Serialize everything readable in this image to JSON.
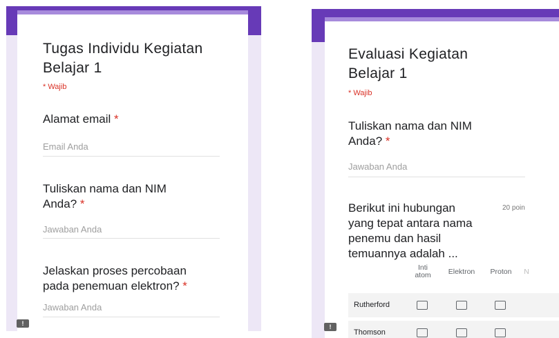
{
  "left_form": {
    "title_line1": "Tugas Individu Kegiatan",
    "title_line2": "Belajar 1",
    "required_note": "* Wajib",
    "q1_label": "Alamat email",
    "q1_placeholder": "Email Anda",
    "q2_line1": "Tuliskan nama dan NIM",
    "q2_line2": "Anda?",
    "q2_placeholder": "Jawaban Anda",
    "q3_line1": "Jelaskan proses percobaan",
    "q3_line2": "pada penemuan elektron?",
    "q3_placeholder": "Jawaban Anda",
    "required_star": "*",
    "feedback_glyph": "!"
  },
  "right_form": {
    "title_line1": "Evaluasi Kegiatan",
    "title_line2": "Belajar 1",
    "required_note": "* Wajib",
    "q1_line1": "Tuliskan nama dan NIM",
    "q1_line2": "Anda?",
    "q1_placeholder": "Jawaban Anda",
    "required_star": "*",
    "q2_line1": "Berikut ini hubungan",
    "q2_line2": "yang tepat antara nama",
    "q2_line3": "penemu dan hasil",
    "q2_line4": "temuannya adalah ...",
    "q2_points": "20 poin",
    "grid_columns": [
      "Inti atom",
      "Elektron",
      "Proton",
      "N"
    ],
    "grid_rows": [
      "Rutherford",
      "Thomson"
    ],
    "feedback_glyph": "!"
  },
  "colors": {
    "purple": "#673ab7",
    "lavender": "#ede7f6",
    "required": "#d93025"
  }
}
